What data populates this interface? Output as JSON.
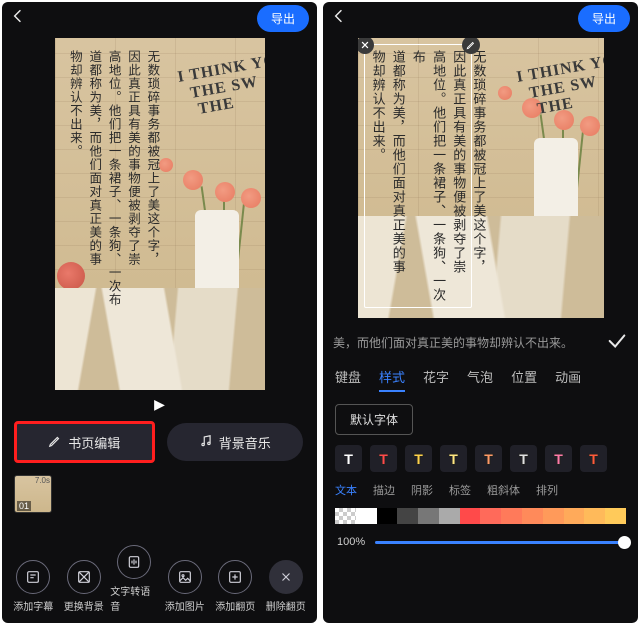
{
  "common": {
    "export_label": "导出",
    "poem_text": "无数琐碎事务都被冠上了美这个字，\n因此真正具有美的事物便被剥夺了崇\n高地位。他们把一条裙子、一条狗、一次布\n道都称为美，而他们面对真正美的事\n物却辨认不出来。",
    "think_text": "I THINK YO\n  THE SW\n   THE"
  },
  "left": {
    "play_icon": "▶",
    "edit_btn": "书页编辑",
    "music_btn": "背景音乐",
    "thumb_num": "01",
    "thumb_dur": "7.0s",
    "tools": [
      {
        "label": "添加字幕"
      },
      {
        "label": "更换背景"
      },
      {
        "label": "文字转语音"
      },
      {
        "label": "添加图片"
      },
      {
        "label": "添加翻页"
      },
      {
        "label": "删除翻页"
      }
    ]
  },
  "right": {
    "textarea_hint": "美，而他们面对真正美的事物却辨认不出来。",
    "style_tabs": [
      "键盘",
      "样式",
      "花字",
      "气泡",
      "位置",
      "动画"
    ],
    "active_style_tab": "样式",
    "font_default": "默认字体",
    "sub_tabs": [
      "文本",
      "描边",
      "阴影",
      "标签",
      "粗斜体",
      "排列"
    ],
    "tstyle_colors": [
      "#ffffff",
      "#ff4a4a",
      "#ffd24a",
      "#ffe680",
      "#ff9a66",
      "#e0e0e0",
      "#ff7aa8",
      "#ff5a3a"
    ],
    "palette_colors": [
      "checker",
      "#ffffff",
      "#000000",
      "#444444",
      "#777777",
      "#aaaaaa",
      "#ff4a4a",
      "#ff6a5a",
      "#ff7a5a",
      "#ff8a5a",
      "#ff9a5a",
      "#ffaa5a",
      "#ffba5a",
      "#ffca5a"
    ],
    "opacity_label": "100%"
  }
}
